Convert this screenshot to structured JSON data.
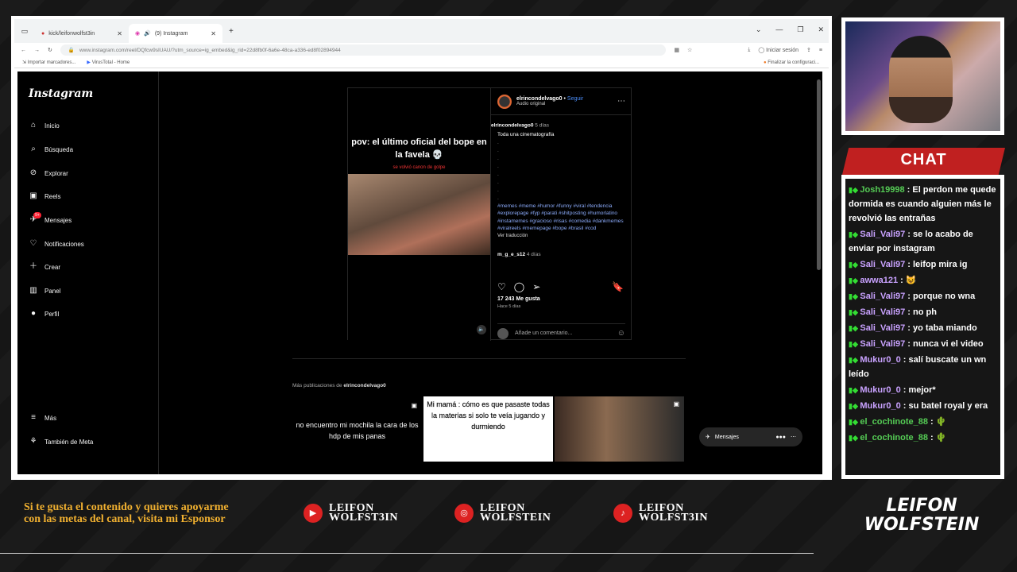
{
  "browser": {
    "tabs": [
      {
        "label": "kick/leifonwolfst3in"
      },
      {
        "label": "(9) Instagram"
      }
    ],
    "url": "www.instagram.com/reel/DQfcw9sIUAU/?utm_source=ig_embed&ig_rid=22d8fb0f-6a6e-48ca-a336-ed8f02894944",
    "signin": "Iniciar sesión",
    "bookmarks": [
      "Importar marcadores...",
      "VirusTotal - Home"
    ],
    "bookmark_right": "Finalizar la configuraci..."
  },
  "instagram": {
    "logo": "Instagram",
    "nav": [
      "Inicio",
      "Búsqueda",
      "Explorar",
      "Reels",
      "Mensajes",
      "Notificaciones",
      "Crear",
      "Panel",
      "Perfil"
    ],
    "nav_bottom": [
      "Más",
      "También de Meta"
    ],
    "messages_badge": "9+",
    "post": {
      "video_text": "pov: el último oficial del bope en la favela 💀",
      "video_sub": "se volvió canon de golpe",
      "author": "elrincondelvago0",
      "follow": "Seguir",
      "audio": "Audio original",
      "caption_author": "elrincondelvago0",
      "caption_time": "5 días",
      "caption": "Toda una cinematografía",
      "tags": "#memes #meme #humor #funny #viral #tendencia #explorepage #fyp #parati #shitposting #humorlatino #instamemes #gracioso #risas #comedia #dankmemes #viralreels #memepage #bope #brasil #cod",
      "translate": "Ver traducción",
      "commenter": "m_g_e_s12",
      "commenter_time": "4 días",
      "likes": "17 243 Me gusta",
      "ago": "Hace 5 días",
      "comment_placeholder": "Añade un comentario..."
    },
    "more_label": "Más publicaciones de",
    "more_author": "elrincondelvago0",
    "thumb1": "no encuentro mi mochila la cara de los hdp de mis panas",
    "thumb2": "Mi mamá : cómo es que pasaste todas la materias si solo te veía jugando y durmiendo",
    "float_messages": "Mensajes"
  },
  "chat": {
    "title": "CHAT",
    "messages": [
      {
        "user": "Josh19998",
        "text": ": El perdon me quede dormida es cuando alguien más le revolvió las entrañas"
      },
      {
        "user": "Sali_Vali97",
        "text": ": se lo acabo de enviar por instagram"
      },
      {
        "user": "Sali_Vali97",
        "text": ": leifop mira ig"
      },
      {
        "user": "awwa121",
        "text": ": 😺"
      },
      {
        "user": "Sali_Vali97",
        "text": ": porque no wna"
      },
      {
        "user": "Sali_Vali97",
        "text": ": no ph"
      },
      {
        "user": "Sali_Vali97",
        "text": ": yo taba miando"
      },
      {
        "user": "Sali_Vali97",
        "text": ": nunca vi el video"
      },
      {
        "user": "Mukur0_0",
        "text": ": salí buscate un wn leído"
      },
      {
        "user": "Mukur0_0",
        "text": ": mejor*"
      },
      {
        "user": "Mukur0_0",
        "text": ": su batel royal y era"
      },
      {
        "user": "el_cochinote_88",
        "text": ": 🌵"
      },
      {
        "user": "el_cochinote_88",
        "text": ": 🌵"
      }
    ]
  },
  "footer": {
    "promo": "Si te gusta el contenido y quieres apoyarme con las metas del canal, visita mi Esponsor",
    "youtube": "LEIFON WOLFST3IN",
    "instagram": "LEIFON WOLFSTEIN",
    "tiktok": "LEIFON WOLFST3IN",
    "brand": "LEIFON WOLFSTEIN"
  },
  "colors": {
    "accent": "#c02020",
    "gold": "#f0b030",
    "link": "#4a8cf7"
  }
}
